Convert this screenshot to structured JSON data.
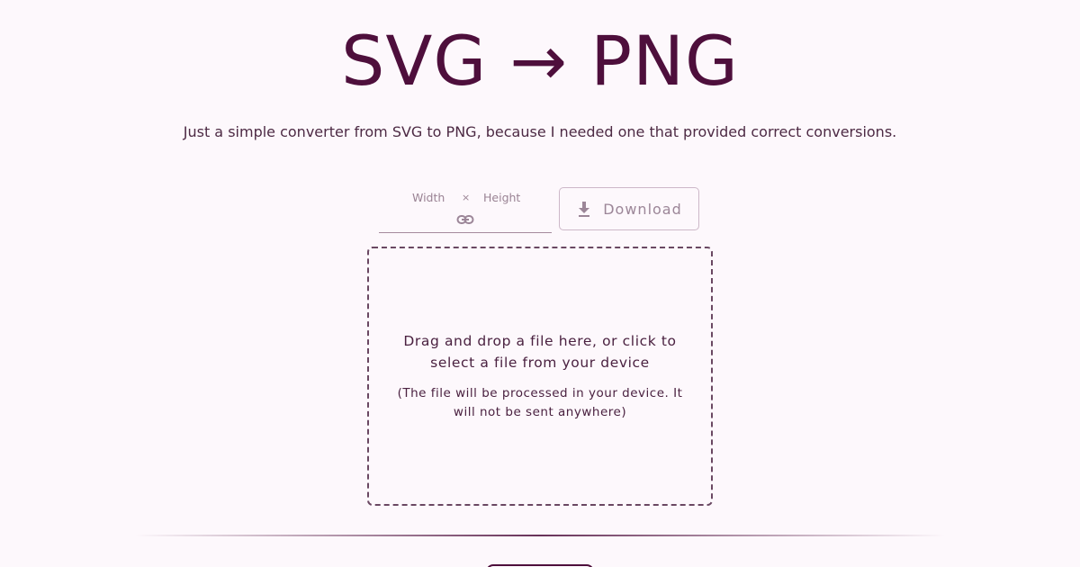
{
  "header": {
    "title": "SVG → PNG",
    "subtitle": "Just a simple converter from SVG to PNG, because I needed one that provided correct conversions."
  },
  "dimensions": {
    "width_label": "Width",
    "separator": "×",
    "height_label": "Height",
    "link_icon": "link-icon"
  },
  "download": {
    "label": "Download",
    "icon": "download-icon"
  },
  "dropzone": {
    "main_text": "Drag and drop a file here, or click to select a file from your device",
    "note_text": "(The file will be processed in your device. It will not be sent anywhere)"
  },
  "colors": {
    "background": "#fdf8fc",
    "accent": "#4e0f3c",
    "muted": "#9c8698"
  }
}
